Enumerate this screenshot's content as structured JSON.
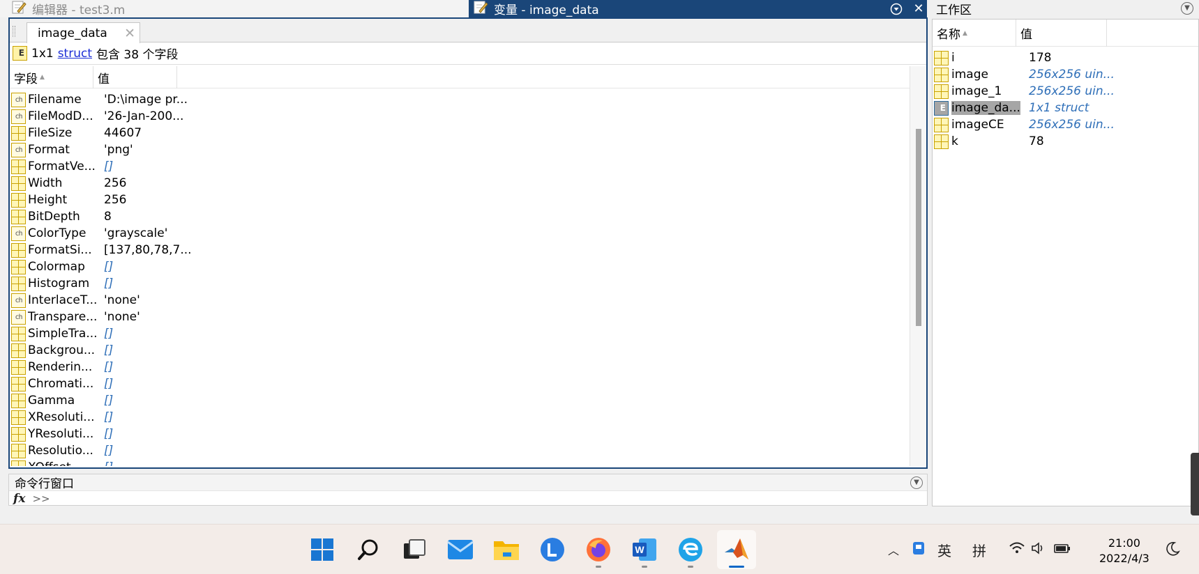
{
  "editor_title": "编辑器 - test3.m",
  "var_title": "变量 - image_data",
  "tab_label": "image_data",
  "info": {
    "prefix": "1x1",
    "link": "struct",
    "suffix": "包含 38 个字段"
  },
  "grid_headers": {
    "field": "字段",
    "value": "值"
  },
  "fields": [
    {
      "name": "Filename",
      "value": "'D:\\image pr...",
      "type": "char"
    },
    {
      "name": "FileModD...",
      "value": "'26-Jan-200...",
      "type": "char"
    },
    {
      "name": "FileSize",
      "value": "44607",
      "type": "num"
    },
    {
      "name": "Format",
      "value": "'png'",
      "type": "char"
    },
    {
      "name": "FormatVe...",
      "value": "[]",
      "type": "empty"
    },
    {
      "name": "Width",
      "value": "256",
      "type": "num"
    },
    {
      "name": "Height",
      "value": "256",
      "type": "num"
    },
    {
      "name": "BitDepth",
      "value": "8",
      "type": "num"
    },
    {
      "name": "ColorType",
      "value": "'grayscale'",
      "type": "char"
    },
    {
      "name": "FormatSi...",
      "value": "[137,80,78,7...",
      "type": "num"
    },
    {
      "name": "Colormap",
      "value": "[]",
      "type": "empty"
    },
    {
      "name": "Histogram",
      "value": "[]",
      "type": "empty"
    },
    {
      "name": "InterlaceT...",
      "value": "'none'",
      "type": "char"
    },
    {
      "name": "Transpare...",
      "value": "'none'",
      "type": "char"
    },
    {
      "name": "SimpleTra...",
      "value": "[]",
      "type": "empty"
    },
    {
      "name": "Backgrou...",
      "value": "[]",
      "type": "empty"
    },
    {
      "name": "Renderin...",
      "value": "[]",
      "type": "empty"
    },
    {
      "name": "Chromati...",
      "value": "[]",
      "type": "empty"
    },
    {
      "name": "Gamma",
      "value": "[]",
      "type": "empty"
    },
    {
      "name": "XResoluti...",
      "value": "[]",
      "type": "empty"
    },
    {
      "name": "YResoluti...",
      "value": "[]",
      "type": "empty"
    },
    {
      "name": "Resolutio...",
      "value": "[]",
      "type": "empty"
    },
    {
      "name": "XOffset",
      "value": "[]",
      "type": "empty"
    }
  ],
  "command_window": {
    "title": "命令行窗口",
    "fx": "fx",
    "prompt": ">>"
  },
  "workspace": {
    "title": "工作区",
    "headers": {
      "name": "名称",
      "value": "值"
    },
    "vars": [
      {
        "name": "i",
        "value": "178",
        "type": "num"
      },
      {
        "name": "image",
        "value": "256x256 uin...",
        "type": "array"
      },
      {
        "name": "image_1",
        "value": "256x256 uin...",
        "type": "array"
      },
      {
        "name": "image_da...",
        "value": "1x1 struct",
        "type": "struct",
        "selected": true
      },
      {
        "name": "imageCE",
        "value": "256x256 uin...",
        "type": "array"
      },
      {
        "name": "k",
        "value": "78",
        "type": "num"
      }
    ]
  },
  "taskbar": {
    "apps": [
      "windows-start-icon",
      "search-icon",
      "task-view-icon",
      "mail-icon",
      "file-explorer-icon",
      "l-app-icon",
      "firefox-icon",
      "word-icon",
      "edge-browser-icon",
      "matlab-icon"
    ],
    "tray": {
      "ime_lang": "英",
      "ime_mode": "拼"
    },
    "time": "21:00",
    "date": "2022/4/3"
  },
  "colors": {
    "accent": "#1a4679",
    "empty_value": "#2f6fb8",
    "icon_yellow": "#fff6b8"
  }
}
